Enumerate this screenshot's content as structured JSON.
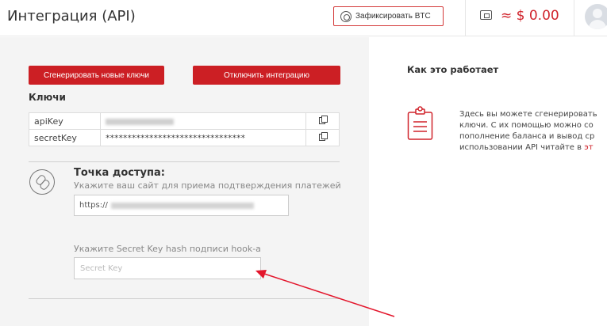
{
  "header": {
    "title": "Интеграция (API)",
    "fix_btc_label": "Зафиксировать BTC",
    "balance": "≈ $ 0.00"
  },
  "actions": {
    "generate_keys": "Сгенерировать новые ключи",
    "disable_integration": "Отключить интеграцию"
  },
  "keys": {
    "title": "Ключи",
    "rows": [
      {
        "name": "apiKey",
        "value": ""
      },
      {
        "name": "secretKey",
        "value": "********************************"
      }
    ]
  },
  "endpoint": {
    "title": "Точка доступа:",
    "description": "Укажите ваш сайт для приема подтверждения платежей",
    "url_prefix": "https://",
    "hook_label": "Укажите Secret Key hash подписи hook-а",
    "secret_placeholder": "Secret Key"
  },
  "how_it_works": {
    "title": "Как это работает",
    "lines": [
      "Здесь вы можете сгенерировать",
      "ключи. С их помощью можно со",
      "пополнение баланса и вывод ср",
      "использовании API читайте в "
    ],
    "link_text": "эт"
  },
  "colors": {
    "accent": "#cc1f24",
    "balance": "#d0232b",
    "arrow": "#e3152b"
  }
}
